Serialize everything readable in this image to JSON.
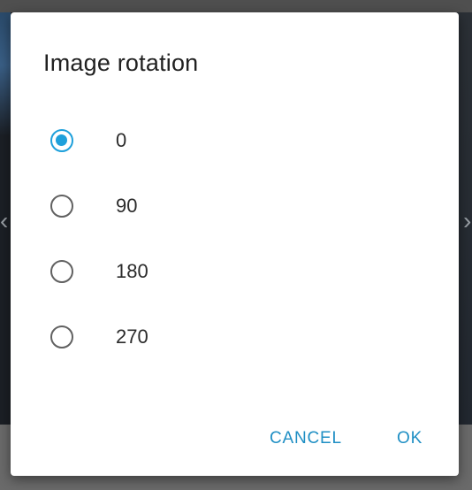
{
  "dialog": {
    "title": "Image rotation",
    "options": [
      {
        "label": "0",
        "selected": true
      },
      {
        "label": "90",
        "selected": false
      },
      {
        "label": "180",
        "selected": false
      },
      {
        "label": "270",
        "selected": false
      }
    ],
    "actions": {
      "cancel_label": "CANCEL",
      "ok_label": "OK"
    }
  },
  "colors": {
    "accent": "#1ea0db",
    "button_text": "#1f8fc4",
    "radio_unchecked": "#616161",
    "dialog_bg": "#ffffff"
  },
  "icons": {
    "radio_checked": "radio-checked-icon",
    "radio_unchecked": "radio-unchecked-icon"
  }
}
